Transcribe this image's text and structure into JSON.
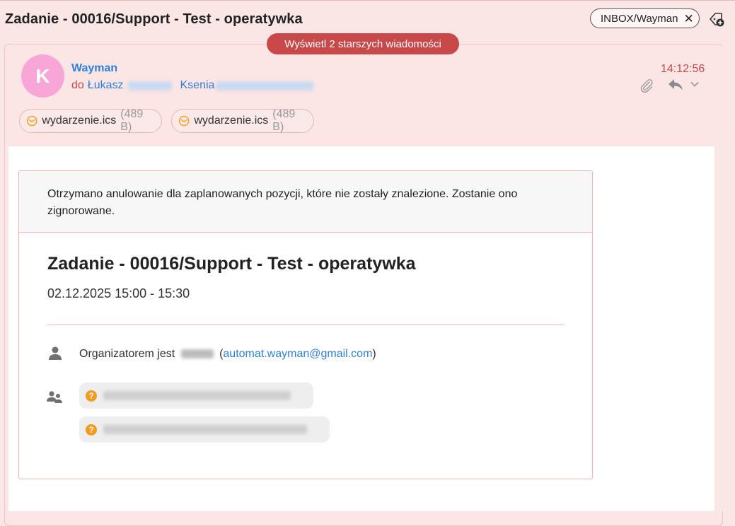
{
  "subject": "Zadanie - 00016/Support - Test - operatywka",
  "folder_tag": {
    "label": "INBOX/Wayman",
    "close": "✕"
  },
  "older_messages_label": "Wyświetl 2 starszych wiadomości",
  "message": {
    "avatar_letter": "K",
    "sender": "Wayman",
    "to_prefix": "do",
    "recipients": [
      "Łukasz",
      "Ksenia"
    ],
    "time": "14:12:56"
  },
  "attachments": [
    {
      "name": "wydarzenie.ics",
      "size": "(489 B)"
    },
    {
      "name": "wydarzenie.ics",
      "size": "(489 B)"
    }
  ],
  "invitation": {
    "notice": "Otrzymano anulowanie dla zaplanowanych pozycji, które nie zostały znalezione. Zostanie ono zignorowane.",
    "title": "Zadanie - 00016/Support - Test - operatywka",
    "datetime": "02.12.2025 15:00 - 15:30",
    "organizer_prefix": "Organizatorem jest",
    "organizer_email": "automat.wayman@gmail.com",
    "attendee_status_icon": "?"
  },
  "colors": {
    "accent_red": "#c9494b",
    "link_blue": "#2f7fd6",
    "background_pink": "#fbe6e6",
    "avatar_pink": "#f8a6d8",
    "attendee_orange": "#f39a1e"
  },
  "icons": [
    "close-icon",
    "tag-add-icon",
    "paperclip-icon",
    "reply-icon",
    "chevron-down-icon",
    "calendar-attachment-icon",
    "person-icon",
    "people-icon",
    "question-icon"
  ]
}
